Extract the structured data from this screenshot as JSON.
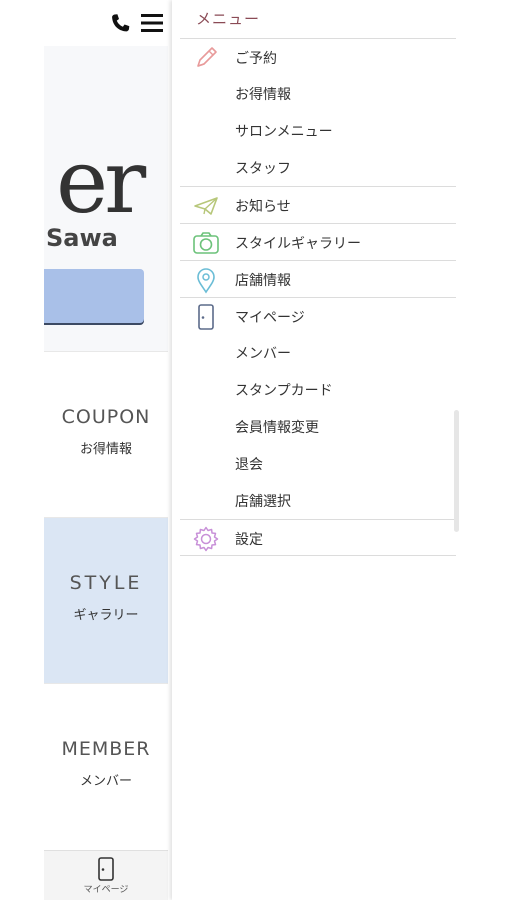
{
  "background": {
    "logo_text": "er",
    "logo_sub": "Sawa",
    "tiles": [
      {
        "en": "COUPON",
        "ja": "お得情報"
      },
      {
        "en": "STYLE",
        "ja": "ギャラリー"
      },
      {
        "en": "MEMBER",
        "ja": "メンバー"
      }
    ],
    "tabbar": {
      "label": "マイページ"
    }
  },
  "drawer": {
    "title": "メニュー",
    "items": [
      {
        "label": "ご予約",
        "icon": "pencil-icon"
      },
      {
        "label": "お得情報"
      },
      {
        "label": "サロンメニュー"
      },
      {
        "label": "スタッフ"
      },
      {
        "label": "お知らせ",
        "icon": "paper-plane-icon"
      },
      {
        "label": "スタイルギャラリー",
        "icon": "camera-icon"
      },
      {
        "label": "店舗情報",
        "icon": "map-pin-icon"
      },
      {
        "label": "マイページ",
        "icon": "door-icon"
      },
      {
        "label": "メンバー"
      },
      {
        "label": "スタンプカード"
      },
      {
        "label": "会員情報変更"
      },
      {
        "label": "退会"
      },
      {
        "label": "店舗選択"
      },
      {
        "label": "設定",
        "icon": "gear-icon"
      }
    ]
  },
  "colors": {
    "drawer_title": "#8a4a55",
    "pencil": "#e89a9a",
    "plane": "#b7c77a",
    "camera": "#6cc27a",
    "pin": "#6bbdd6",
    "door": "#5c6b8a",
    "gear": "#c890d8",
    "hero_button": "#a9c0e8",
    "style_tile": "#dbe6f4"
  }
}
